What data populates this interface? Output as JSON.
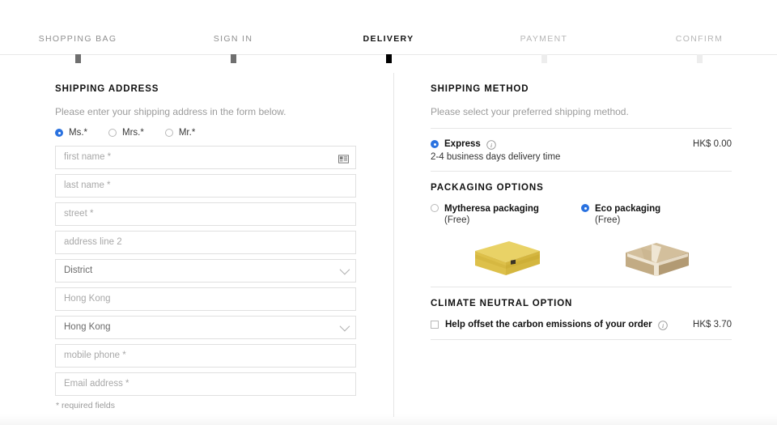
{
  "stepper": {
    "steps": [
      {
        "label": "SHOPPING BAG",
        "state": "done"
      },
      {
        "label": "SIGN IN",
        "state": "done"
      },
      {
        "label": "DELIVERY",
        "state": "current"
      },
      {
        "label": "PAYMENT",
        "state": "todo"
      },
      {
        "label": "CONFIRM",
        "state": "todo"
      }
    ]
  },
  "shipping_address": {
    "title": "SHIPPING ADDRESS",
    "subtitle": "Please enter your shipping address in the form below.",
    "salutation": {
      "options": [
        {
          "label": "Ms.*",
          "selected": true
        },
        {
          "label": "Mrs.*",
          "selected": false
        },
        {
          "label": "Mr.*",
          "selected": false
        }
      ]
    },
    "fields": [
      {
        "name": "first-name",
        "placeholder": "first name *",
        "type": "text",
        "icon": "contact-card-icon"
      },
      {
        "name": "last-name",
        "placeholder": "last name *",
        "type": "text"
      },
      {
        "name": "street",
        "placeholder": "street *",
        "type": "text"
      },
      {
        "name": "address-line-2",
        "placeholder": "address line 2",
        "type": "text"
      },
      {
        "name": "district",
        "placeholder": "District",
        "type": "select"
      },
      {
        "name": "city",
        "placeholder": "Hong Kong",
        "type": "text"
      },
      {
        "name": "country",
        "placeholder": "Hong Kong",
        "type": "select"
      },
      {
        "name": "mobile-phone",
        "placeholder": "mobile phone *",
        "type": "text"
      },
      {
        "name": "email-address",
        "placeholder": "Email address *",
        "type": "text"
      }
    ],
    "required_note": "* required fields"
  },
  "shipping_method": {
    "title": "SHIPPING METHOD",
    "subtitle": "Please select your preferred shipping method.",
    "options": [
      {
        "name": "Express",
        "selected": true,
        "description": "2-4 business days delivery time",
        "price": "HK$ 0.00",
        "info_icon": "info-icon"
      }
    ]
  },
  "packaging_options": {
    "title": "PACKAGING OPTIONS",
    "options": [
      {
        "name": "Mytheresa packaging",
        "price_label": "(Free)",
        "selected": false,
        "image": "yellow-gift-box"
      },
      {
        "name": "Eco packaging",
        "price_label": "(Free)",
        "selected": true,
        "image": "cardboard-box"
      }
    ]
  },
  "climate_neutral": {
    "title": "CLIMATE NEUTRAL OPTION",
    "checkbox_label": "Help offset the carbon emissions of your order",
    "checked": false,
    "price": "HK$ 3.70",
    "info_icon": "info-icon"
  },
  "colors": {
    "accent_blue": "#2a72e0",
    "text_dark": "#111111",
    "text_muted": "#9b9b9b",
    "border": "#e0e0e0",
    "gift_box_yellow": "#e2c64e",
    "eco_box_tan": "#cbb894"
  }
}
